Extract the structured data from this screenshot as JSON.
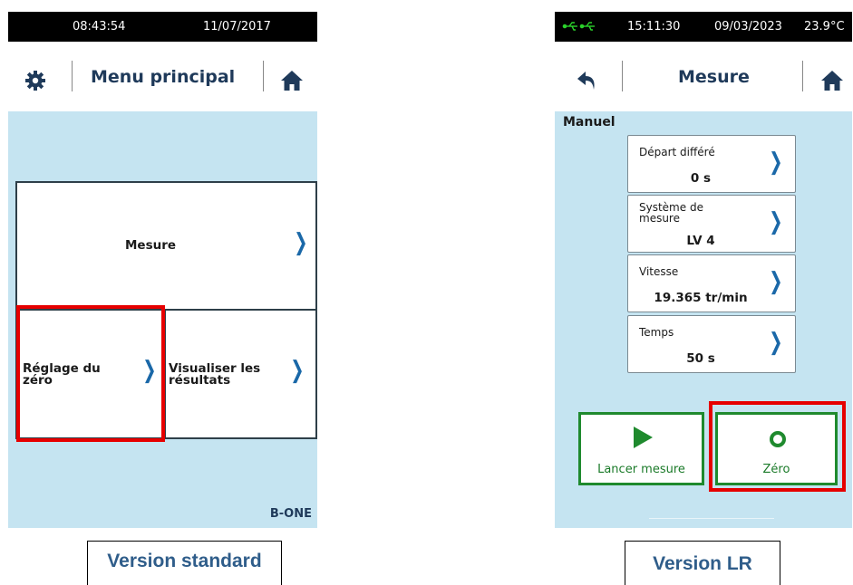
{
  "left": {
    "status": {
      "time": "08:43:54",
      "date": "11/07/2017"
    },
    "header": {
      "title": "Menu principal",
      "settings_icon": "gear-icon",
      "home_icon": "home-icon"
    },
    "tiles": {
      "measure": "Mesure",
      "zero_line1": "Réglage du",
      "zero_line2": "zéro",
      "results_line1": "Visualiser les",
      "results_line2": "résultats"
    },
    "brand": "B-ONE",
    "caption": "Version standard"
  },
  "right": {
    "status": {
      "time": "15:11:30",
      "date": "09/03/2023",
      "temperature": "23.9°C",
      "usb_icon": "usb-icon"
    },
    "header": {
      "title": "Mesure",
      "back_icon": "back-arrow-icon",
      "home_icon": "home-icon"
    },
    "mode": "Manuel",
    "params": [
      {
        "label": "Départ différé",
        "value": "0 s"
      },
      {
        "label_line1": "Système de",
        "label_line2": "mesure",
        "value": "LV 4"
      },
      {
        "label": "Vitesse",
        "value": "19.365 tr/min"
      },
      {
        "label": "Temps",
        "value": "50 s"
      }
    ],
    "buttons": {
      "start": "Lancer mesure",
      "zero": "Zéro"
    },
    "caption": "Version LR"
  },
  "colors": {
    "screen_bg": "#c5e4f1",
    "highlight": "#e60000",
    "green": "#1f8a2e",
    "chevron": "#1a68a8",
    "title": "#1f3a5a"
  }
}
